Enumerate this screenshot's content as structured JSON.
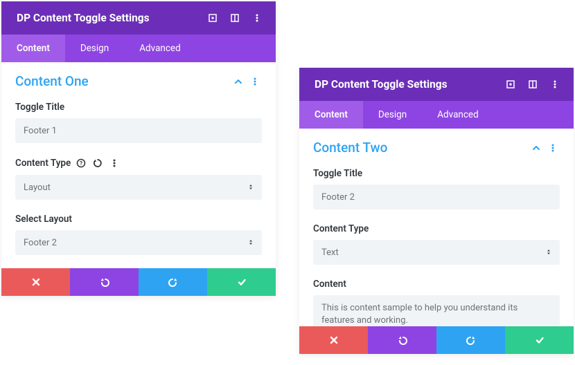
{
  "panel_a": {
    "header": {
      "title": "DP Content Toggle Settings"
    },
    "tabs": [
      {
        "label": "Content",
        "active": true
      },
      {
        "label": "Design"
      },
      {
        "label": "Advanced"
      }
    ],
    "section": {
      "title": "Content One"
    },
    "fields": {
      "toggle_title": {
        "label": "Toggle Title",
        "value": "Footer 1"
      },
      "content_type": {
        "label": "Content Type",
        "value": "Layout"
      },
      "select_layout": {
        "label": "Select Layout",
        "value": "Footer 2"
      }
    }
  },
  "panel_b": {
    "header": {
      "title": "DP Content Toggle Settings"
    },
    "tabs": [
      {
        "label": "Content",
        "active": true
      },
      {
        "label": "Design"
      },
      {
        "label": "Advanced"
      }
    ],
    "section": {
      "title": "Content Two"
    },
    "fields": {
      "toggle_title": {
        "label": "Toggle Title",
        "value": "Footer 2"
      },
      "content_type": {
        "label": "Content Type",
        "value": "Text"
      },
      "content": {
        "label": "Content",
        "value": "This is content sample to help you understand its features and working."
      }
    }
  }
}
